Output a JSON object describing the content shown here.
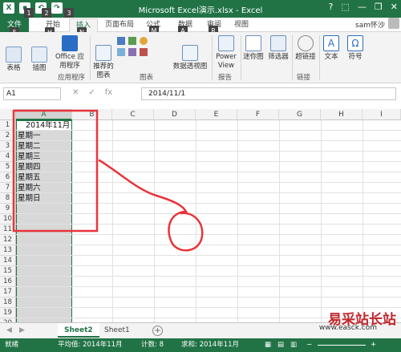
{
  "window": {
    "title": "Microsoft Excel演示.xlsx - Excel",
    "help": "?",
    "minimize": "—",
    "restore": "❐",
    "close": "✕"
  },
  "keytips": [
    "1",
    "2",
    "3",
    "F",
    "H",
    "N",
    "P",
    "M",
    "A",
    "R"
  ],
  "tabs": [
    "文件",
    "开始",
    "插入",
    "页面布局",
    "公式",
    "数据",
    "审阅",
    "视图"
  ],
  "user": "sam怀沙",
  "ribbon": {
    "buttons": [
      "表格",
      "插图",
      "Office 应用程序",
      "推荐的 图表",
      "数据透视图",
      "Power View",
      "迷你图",
      "筛选器",
      "超链接",
      "文本",
      "符号"
    ],
    "groups": [
      "应用程序",
      "图表",
      "报告",
      "链接"
    ]
  },
  "formula_bar": {
    "name_box": "A1",
    "cancel": "✕",
    "enter": "✓",
    "fx": "fx",
    "value": "2014/11/1"
  },
  "grid": {
    "columns": [
      "A",
      "B",
      "C",
      "D",
      "E",
      "F",
      "G",
      "H",
      "I"
    ],
    "rows": [
      "1",
      "2",
      "3",
      "4",
      "5",
      "6",
      "7",
      "8",
      "9",
      "10",
      "11",
      "12",
      "13",
      "14",
      "15",
      "16",
      "17",
      "18",
      "19",
      "20"
    ],
    "cells": {
      "A1": "2014年11月",
      "A2": "星期一",
      "A3": "星期二",
      "A4": "星期三",
      "A5": "星期四",
      "A6": "星期五",
      "A7": "星期六",
      "A8": "星期日"
    }
  },
  "sheets": {
    "tabs": [
      "Sheet2",
      "Sheet1"
    ],
    "active": "Sheet2",
    "add": "+",
    "prev": "◀",
    "next": "▶"
  },
  "status": {
    "ready": "就绪",
    "average": "平均值: 2014年11月",
    "count": "计数: 8",
    "sum": "求和: 2014年11月"
  },
  "watermark": {
    "logo": "易采站长站",
    "url": "www.easck.com"
  },
  "colors": {
    "excel_green": "#217346",
    "annotation_red": "#e8353a"
  }
}
